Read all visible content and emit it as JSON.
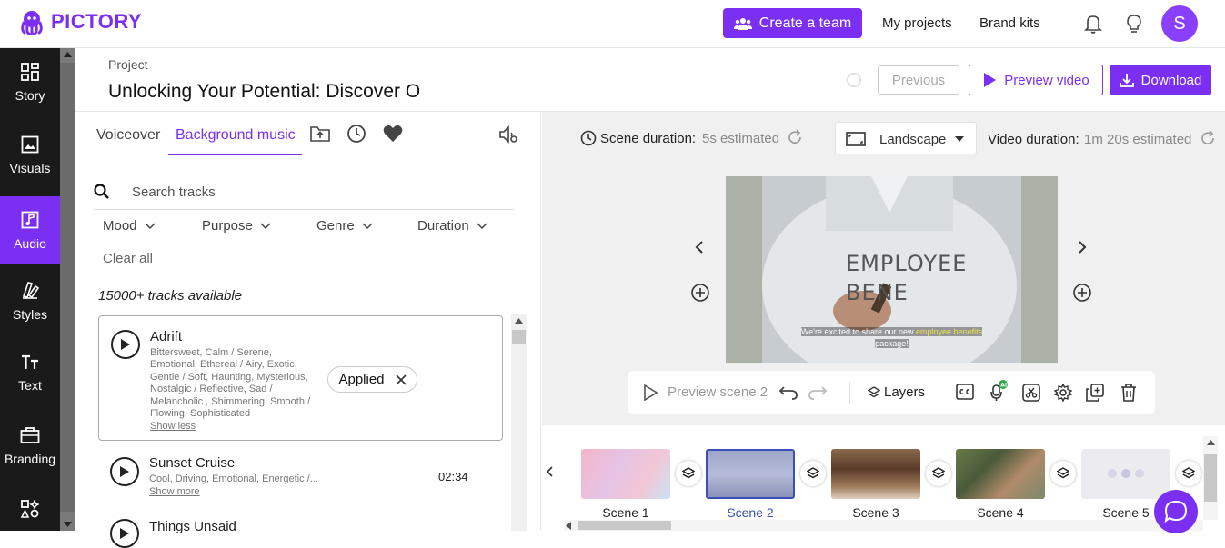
{
  "brand": {
    "name": "PICTORY",
    "color": "#7b2ff2"
  },
  "topbar": {
    "create_team": "Create a team",
    "my_projects": "My projects",
    "brand_kits": "Brand kits",
    "avatar_initial": "S"
  },
  "sidebar": {
    "items": [
      {
        "label": "Story",
        "icon": "grid-icon"
      },
      {
        "label": "Visuals",
        "icon": "image-icon"
      },
      {
        "label": "Audio",
        "icon": "music-note-icon",
        "active": true
      },
      {
        "label": "Styles",
        "icon": "palette-icon"
      },
      {
        "label": "Text",
        "icon": "text-icon"
      },
      {
        "label": "Branding",
        "icon": "briefcase-icon"
      }
    ]
  },
  "project": {
    "label": "Project",
    "title": "Unlocking Your Potential: Discover Our Employee Benefits",
    "previous": "Previous",
    "preview_video": "Preview video",
    "download": "Download"
  },
  "audio_panel": {
    "tabs": [
      "Voiceover",
      "Background music"
    ],
    "active_tab": "Background music",
    "search_placeholder": "Search tracks",
    "filters": [
      "Mood",
      "Purpose",
      "Genre",
      "Duration"
    ],
    "clear_all": "Clear all",
    "available": "15000+ tracks available",
    "tracks": [
      {
        "name": "Adrift",
        "tags": [
          "Bittersweet, Calm / Serene,",
          "Emotional, Ethereal / Airy, Exotic,",
          "Gentle / Soft, Haunting, Mysterious,",
          "Nostalgic / Reflective, Sad /",
          "Melancholic , Shimmering, Smooth /",
          "Flowing, Sophisticated"
        ],
        "toggle": "Show less",
        "status": "Applied"
      },
      {
        "name": "Sunset Cruise",
        "tags": [
          "Cool, Driving, Emotional, Energetic /..."
        ],
        "toggle": "Show more",
        "duration": "02:34"
      },
      {
        "name": "Things Unsaid"
      }
    ]
  },
  "workspace": {
    "scene_duration_label": "Scene duration:",
    "scene_duration_value": "5s estimated",
    "orientation": "Landscape",
    "video_duration_label": "Video duration:",
    "video_duration_value": "1m 20s estimated",
    "video_text": [
      "EMPLOYEE",
      "BENE"
    ],
    "caption_line1_pre": "We're excited to share our new ",
    "caption_line1_hl": "employee benefits",
    "caption_line2": "package!",
    "preview_scene": "Preview scene 2",
    "layers": "Layers",
    "scenes": [
      "Scene 1",
      "Scene 2",
      "Scene 3",
      "Scene 4",
      "Scene 5"
    ],
    "selected_scene": "Scene 2"
  }
}
